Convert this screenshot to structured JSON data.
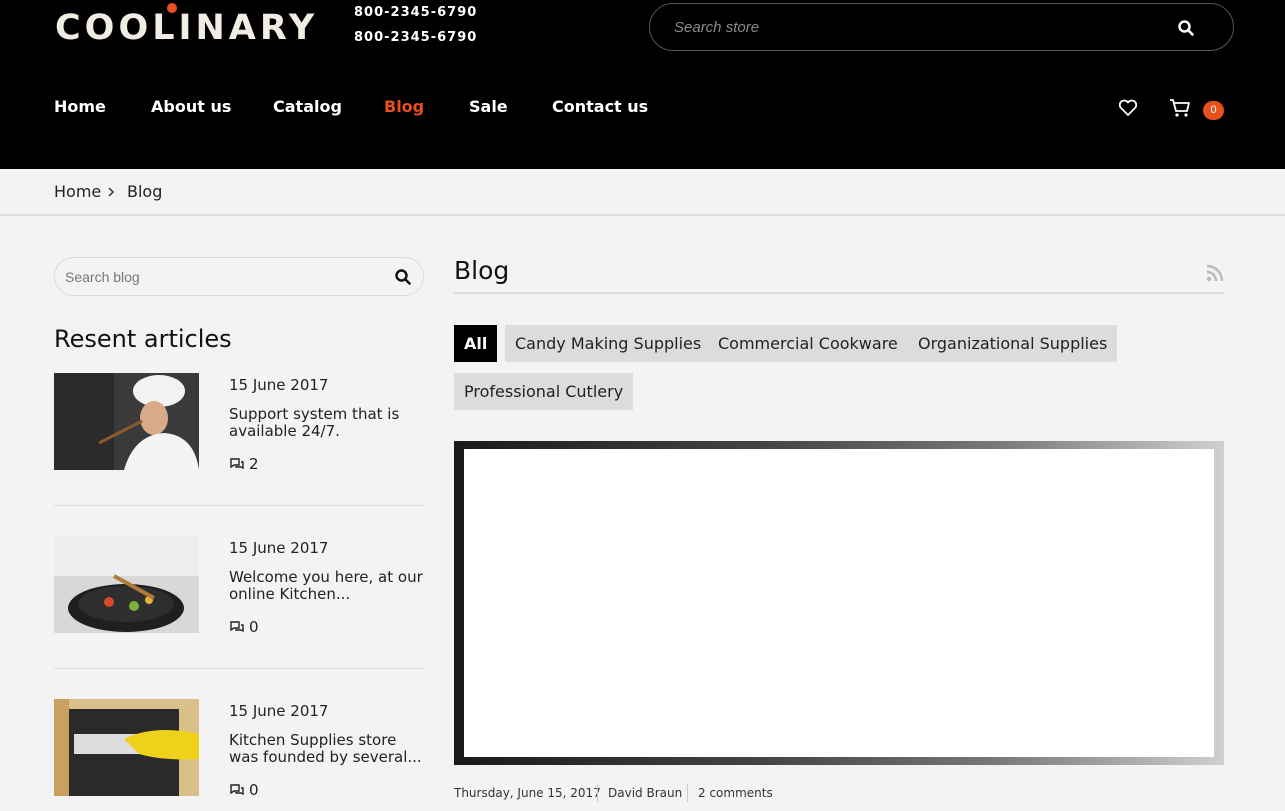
{
  "header": {
    "logo": "COOLINARY",
    "phones": [
      "800-2345-6790",
      "800-2345-6790"
    ],
    "search_placeholder": "Search store",
    "nav": [
      "Home",
      "About us",
      "Catalog",
      "Blog",
      "Sale",
      "Contact us"
    ],
    "active_nav": "Blog",
    "cart_count": "0"
  },
  "breadcrumb": [
    "Home",
    "Blog"
  ],
  "sidebar": {
    "search_placeholder": "Search blog",
    "title": "Resent articles",
    "articles": [
      {
        "date": "15 June 2017",
        "title": "Support system that is available 24/7.",
        "comments": "2"
      },
      {
        "date": "15 June 2017",
        "title": "Welcome you here, at our online Kitchen...",
        "comments": "0"
      },
      {
        "date": "15 June 2017",
        "title": "Kitchen Supplies store was founded by several...",
        "comments": "0"
      }
    ]
  },
  "main": {
    "title": "Blog",
    "tags": [
      "All",
      "Candy Making Supplies",
      "Commercial Cookware",
      "Organizational Supplies",
      "Professional Cutlery"
    ],
    "post_meta": {
      "date": "Thursday, June 15, 2017",
      "author": "David Braun",
      "comments": "2 comments"
    }
  },
  "colors": {
    "accent": "#e8501f",
    "header_bg": "#000000",
    "page_bg": "#f3f3f3"
  }
}
